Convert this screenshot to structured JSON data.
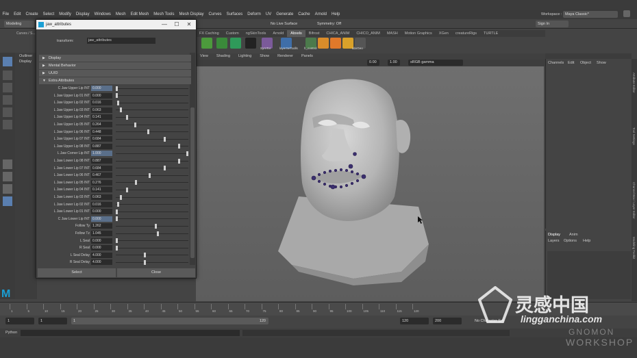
{
  "menu": [
    "File",
    "Edit",
    "Create",
    "Select",
    "Modify",
    "Display",
    "Windows",
    "Mesh",
    "Edit Mesh",
    "Mesh Tools",
    "Mesh Display",
    "Curves",
    "Surfaces",
    "Deform",
    "UV",
    "Generate",
    "Cache",
    "Arnold",
    "Help"
  ],
  "workspace": {
    "label": "Workspace :",
    "value": "Maya Classic*"
  },
  "status": {
    "mode": "Modeling",
    "live_surface": "No Live Surface",
    "symmetry": "Symmetry: Off",
    "sign_in": "Sign In"
  },
  "shelf_tabs": [
    "FX Caching",
    "Custom",
    "ngSkinTools",
    "Arnold",
    "Abxels",
    "Bifrost",
    "CHICA_ANIM",
    "CHICO_ANIM",
    "MASH",
    "Motion Graphics",
    "XGen",
    "creatureRigs",
    "TURTLE"
  ],
  "shelf_active": "Abxels",
  "shelf_labels": [
    "SymTor",
    "layerSeToolls",
    "h_control",
    "",
    "",
    "",
    "",
    "",
    "",
    "abxGeo"
  ],
  "left_panel": {
    "tab1": "Curves / S...",
    "outliner": "Outliner",
    "display": "Display"
  },
  "viewport_menu": [
    "View",
    "Shading",
    "Lighting",
    "Show",
    "Renderer",
    "Panels"
  ],
  "viewport_fields": {
    "exposure": "0.00",
    "gamma": "1.00",
    "color_space": "sRGB gamma"
  },
  "channel_box": {
    "tabs": [
      "Channels",
      "Edit",
      "Object",
      "Show"
    ]
  },
  "layer_panel": {
    "tabs": [
      "Display",
      "Anim"
    ],
    "menu": [
      "Layers",
      "Options",
      "Help"
    ]
  },
  "right_strip_labels": [
    "Attribute Editor",
    "Tool Settings",
    "Channel Box / Layer Editor",
    "Modeling Toolkit"
  ],
  "dialog": {
    "title": "jaw_attributes",
    "window_buttons": [
      "—",
      "☐",
      "✕"
    ],
    "transform_label": "transform:",
    "transform_value": "jaw_attributes",
    "sections": [
      "Display",
      "Mental Behavior",
      "UUID",
      "Extra Attributes"
    ],
    "attributes": [
      {
        "label": "C Jaw Upper Lip INT",
        "value": "0.000",
        "level": 0.0,
        "highlight": true
      },
      {
        "label": "L Jaw Upper Lip 01 INT",
        "value": "0.000",
        "level": 0.0
      },
      {
        "label": "L Jaw Upper Lip 02 INT",
        "value": "0.016",
        "level": 0.016
      },
      {
        "label": "L Jaw Upper Lip 03 INT",
        "value": "0.063",
        "level": 0.063
      },
      {
        "label": "L Jaw Upper Lip 04 INT",
        "value": "0.141",
        "level": 0.141
      },
      {
        "label": "L Jaw Upper Lip 05 INT",
        "value": "0.264",
        "level": 0.264
      },
      {
        "label": "L Jaw Upper Lip 06 INT",
        "value": "0.448",
        "level": 0.448
      },
      {
        "label": "L Jaw Upper Lip 07 INT",
        "value": "0.684",
        "level": 0.684
      },
      {
        "label": "L Jaw Upper Lip 08 INT",
        "value": "0.887",
        "level": 0.887
      },
      {
        "label": "L Jaw Corner Lip INT",
        "value": "1.000",
        "level": 1.0,
        "highlight": true
      },
      {
        "label": "L Jaw Lower Lip 08 INT",
        "value": "0.887",
        "level": 0.887
      },
      {
        "label": "L Jaw Lower Lip 07 INT",
        "value": "0.684",
        "level": 0.684
      },
      {
        "label": "L Jaw Lower Lip 06 INT",
        "value": "0.467",
        "level": 0.467
      },
      {
        "label": "L Jaw Lower Lip 05 INT",
        "value": "0.276",
        "level": 0.276
      },
      {
        "label": "L Jaw Lower Lip 04 INT",
        "value": "0.141",
        "level": 0.141
      },
      {
        "label": "L Jaw Lower Lip 03 INT",
        "value": "0.063",
        "level": 0.063
      },
      {
        "label": "L Jaw Lower Lip 02 INT",
        "value": "0.016",
        "level": 0.016
      },
      {
        "label": "L Jaw Lower Lip 01 INT",
        "value": "0.000",
        "level": 0.0
      },
      {
        "label": "C Jaw Lower Lip INT",
        "value": "0.000",
        "level": 0.0,
        "highlight": true
      },
      {
        "label": "Follow Ty",
        "value": "1.262",
        "level": 0.55
      },
      {
        "label": "Follow Tz",
        "value": "1.045",
        "level": 0.58
      },
      {
        "label": "L Seal",
        "value": "0.000",
        "level": 0.0
      },
      {
        "label": "R Seal",
        "value": "0.000",
        "level": 0.0
      },
      {
        "label": "L Seal Delay",
        "value": "4.000",
        "level": 0.4
      },
      {
        "label": "R Seal Delay",
        "value": "4.000",
        "level": 0.4
      }
    ],
    "select_button": "Select",
    "close_button": "Close"
  },
  "timeline_ticks": [
    "1",
    "5",
    "10",
    "15",
    "20",
    "25",
    "30",
    "35",
    "40",
    "45",
    "50",
    "55",
    "60",
    "65",
    "70",
    "75",
    "80",
    "85",
    "90",
    "95",
    "100",
    "105",
    "110",
    "115",
    "120"
  ],
  "range": {
    "start": "1",
    "start2": "1",
    "frame": "1",
    "range_end": "120",
    "end": "120",
    "end2": "200",
    "character_set": "No Character Set"
  },
  "python_label": "Python",
  "watermark": {
    "main": "灵感中国",
    "url": "lingganchina.com",
    "sub1": "GNOMON",
    "sub2": "WORKSHOP"
  },
  "colors": {
    "accent": "#1b9fd4",
    "bg": "#444444",
    "locator": "#3b2f6e"
  }
}
